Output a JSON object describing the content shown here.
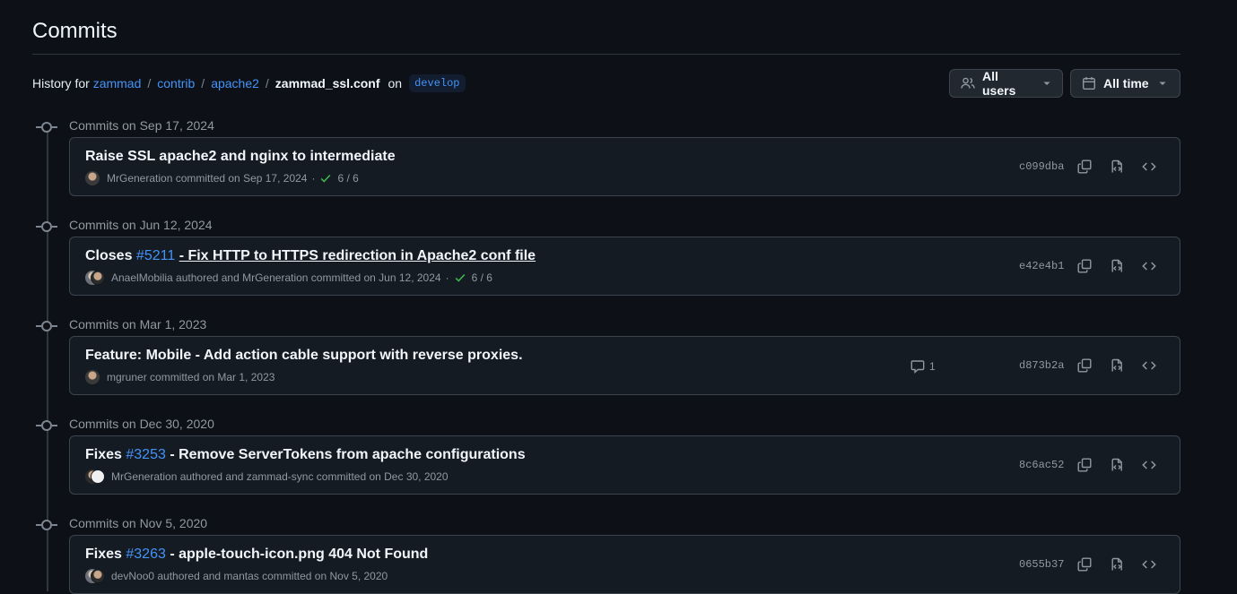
{
  "page": {
    "title": "Commits"
  },
  "history": {
    "prefix": "History for",
    "crumbs": [
      "zammad",
      "contrib",
      "apache2"
    ],
    "file": "zammad_ssl.conf",
    "on": "on",
    "branch": "develop"
  },
  "filters": {
    "users": "All users",
    "time": "All time"
  },
  "groups": [
    {
      "date": "Commits on Sep 17, 2024",
      "commit": {
        "message": "Raise SSL apache2 and nginx to intermediate",
        "meta": "MrGeneration committed on Sep 17, 2024",
        "checks": "6 / 6",
        "sha": "c099dba"
      }
    },
    {
      "date": "Commits on Jun 12, 2024",
      "commit": {
        "message_prefix": "Closes",
        "issue": "#5211",
        "message_suffix": "- Fix HTTP to HTTPS redirection in Apache2 conf file",
        "meta": "AnaelMobilia authored and MrGeneration committed on Jun 12, 2024",
        "checks": "6 / 6",
        "sha": "e42e4b1"
      }
    },
    {
      "date": "Commits on Mar 1, 2023",
      "commit": {
        "message": "Feature: Mobile - Add action cable support with reverse proxies.",
        "meta": "mgruner committed on Mar 1, 2023",
        "comments": "1",
        "sha": "d873b2a"
      }
    },
    {
      "date": "Commits on Dec 30, 2020",
      "commit": {
        "message_prefix": "Fixes",
        "issue": "#3253",
        "message_suffix": "- Remove ServerTokens from apache configurations",
        "meta": "MrGeneration authored and zammad-sync committed on Dec 30, 2020",
        "sha": "8c6ac52"
      }
    },
    {
      "date": "Commits on Nov 5, 2020",
      "commit": {
        "message_prefix": "Fixes",
        "issue": "#3263",
        "message_suffix": "- apple-touch-icon.png 404 Not Found",
        "meta": "devNoo0 authored and mantas committed on Nov 5, 2020",
        "sha": "0655b37"
      }
    }
  ],
  "icons": {
    "users": "people-icon",
    "time": "calendar-icon",
    "copy": "copy-icon",
    "browse": "file-code-icon",
    "code": "code-icon",
    "check": "check-icon",
    "comment": "comment-icon"
  },
  "colors": {
    "background": "#0d1117",
    "link": "#4493f8",
    "success": "#3fb950",
    "muted": "#9198a1"
  }
}
